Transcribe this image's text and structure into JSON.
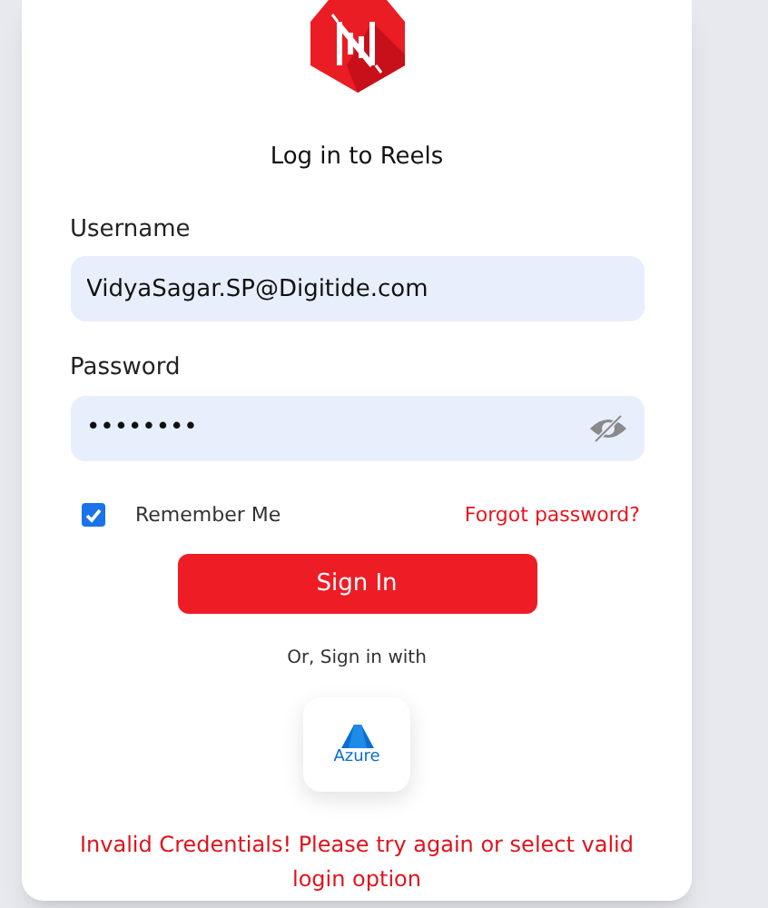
{
  "title": "Log in to Reels",
  "username": {
    "label": "Username",
    "value": "VidyaSagar.SP@Digitide.com"
  },
  "password": {
    "label": "Password",
    "value": "••••••••",
    "visible": false
  },
  "remember": {
    "label": "Remember Me",
    "checked": true
  },
  "forgot": "Forgot password?",
  "sign_in": "Sign In",
  "alt_label": "Or, Sign in with",
  "azure": {
    "label": "Azure"
  },
  "error": "Invalid Credentials! Please try again or select valid login option"
}
